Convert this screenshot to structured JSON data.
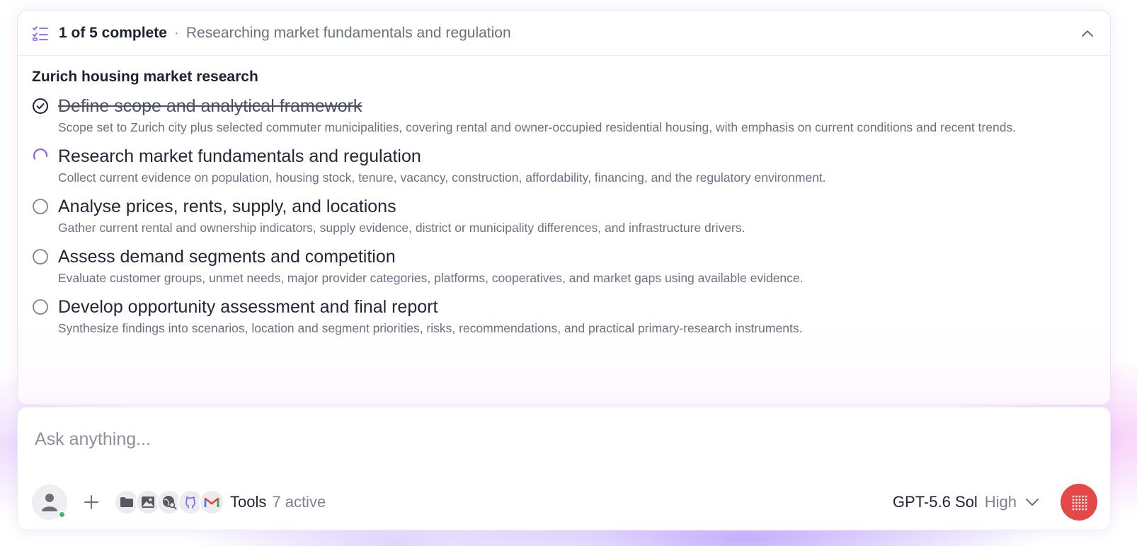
{
  "plan": {
    "progress": "1 of 5 complete",
    "separator": "·",
    "current_step": "Researching market fundamentals and regulation",
    "title": "Zurich housing market research",
    "tasks": [
      {
        "title": "Define scope and analytical framework",
        "description": "Scope set to Zurich city plus selected commuter municipalities, covering rental and owner-occupied residential housing, with emphasis on current conditions and recent trends.",
        "status": "done"
      },
      {
        "title": "Research market fundamentals and regulation",
        "description": "Collect current evidence on population, housing stock, tenure, vacancy, construction, affordability, financing, and the regulatory environment.",
        "status": "in-progress"
      },
      {
        "title": "Analyse prices, rents, supply, and locations",
        "description": "Gather current rental and ownership indicators, supply evidence, district or municipality differences, and infrastructure drivers.",
        "status": "pending"
      },
      {
        "title": "Assess demand segments and competition",
        "description": "Evaluate customer groups, unmet needs, major provider categories, platforms, cooperatives, and market gaps using available evidence.",
        "status": "pending"
      },
      {
        "title": "Develop opportunity assessment and final report",
        "description": "Synthesize findings into scenarios, location and segment priorities, risks, recommendations, and practical primary-research instruments.",
        "status": "pending"
      }
    ]
  },
  "composer": {
    "placeholder": "Ask anything...",
    "value": "",
    "tools_label": "Tools",
    "tools_count": "7 active",
    "tool_icons": [
      "folder-icon",
      "image-icon",
      "web-search-icon",
      "github-icon",
      "gmail-icon"
    ],
    "model": "GPT-5.6 Sol",
    "effort": "High"
  },
  "colors": {
    "accent_purple": "#8b5cf6",
    "voice_button": "#e64848",
    "online": "#30c26a"
  }
}
